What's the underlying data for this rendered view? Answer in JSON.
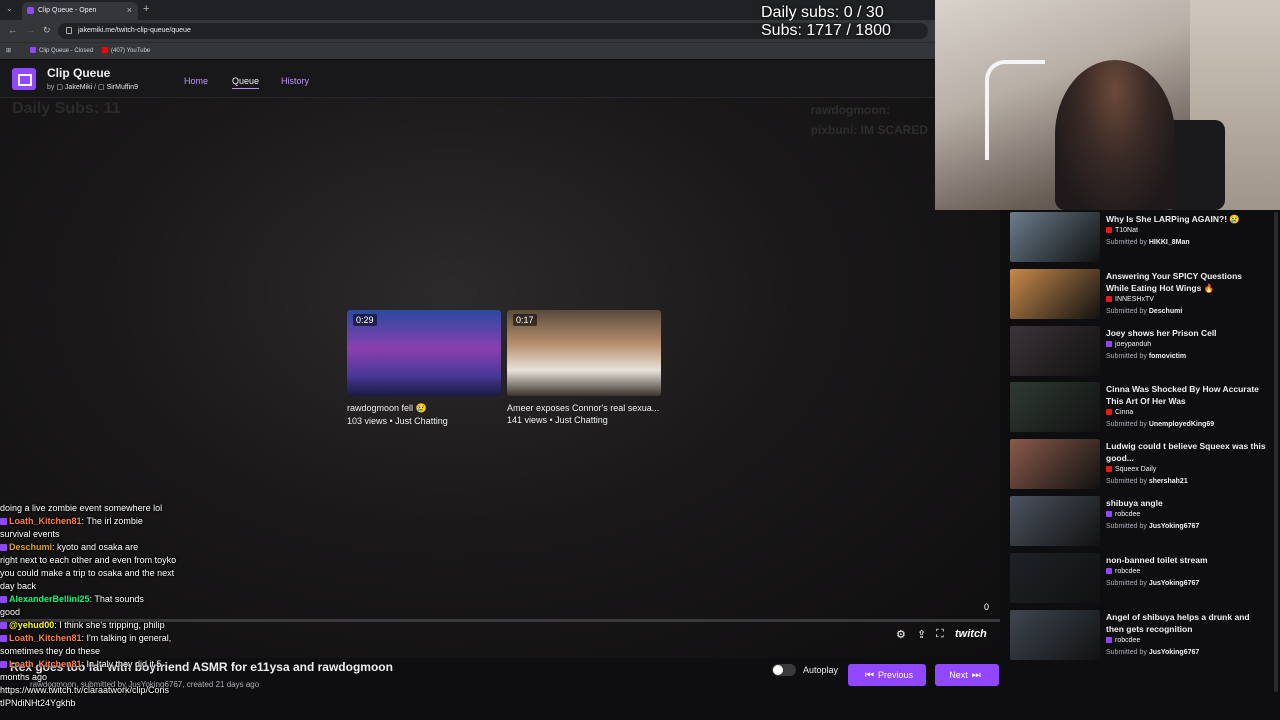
{
  "browser": {
    "tab_title": "Clip Queue - Open",
    "url": "jakemiki.me/twitch-clip-queue/queue",
    "bookmarks": [
      "Clip Queue - Closed",
      "(407) YouTube"
    ]
  },
  "app": {
    "title": "Clip Queue",
    "by_prefix": "by",
    "author1": "JakeMiki",
    "author_sep": "/",
    "author2": "SirMuffin9",
    "nav": [
      "Home",
      "Queue",
      "History"
    ]
  },
  "stage": {
    "ghost_left": "Daily Subs: 11",
    "ghost_right": [
      "rawdogmoon:",
      "pixbuni: IM SCARED"
    ]
  },
  "recommendations": [
    {
      "duration": "0:29",
      "title": "rawdogmoon fell 😢",
      "meta": "103 views • Just Chatting"
    },
    {
      "duration": "0:17",
      "title": "Ameer exposes Connor's real sexua...",
      "meta": "141 views • Just Chatting"
    }
  ],
  "player": {
    "progress": 0.0,
    "counter": "0",
    "twitch_word": "twitch"
  },
  "clip": {
    "title": "Rex goes too far with boyfriend ASMR for e11ysa and rawdogmoon",
    "subtitle": "rawdogmoon, submitted by JusYoking6767, created 21 days ago"
  },
  "controls": {
    "autoplay_label": "Autoplay",
    "previous_label": "Previous",
    "next_label": "Next"
  },
  "chat": [
    {
      "user": "",
      "text": "doing a live zombie event somewhere lol",
      "color": "#ffffff"
    },
    {
      "user": "Loath_Kitchen81",
      "text": ": The irl zombie",
      "color": "#ff7f50"
    },
    {
      "user": "",
      "text": "survival events",
      "color": "#ffffff"
    },
    {
      "user": "Deschumi",
      "text": ": kyoto and osaka are",
      "color": "#daa520"
    },
    {
      "user": "",
      "text": "right next to each other and even from toyko",
      "color": "#ffffff"
    },
    {
      "user": "",
      "text": "you could make a trip to osaka and the next",
      "color": "#ffffff"
    },
    {
      "user": "",
      "text": "day back",
      "color": "#ffffff"
    },
    {
      "user": "AlexanderBellini25",
      "text": ": That sounds",
      "color": "#00ff7f"
    },
    {
      "user": "",
      "text": "good",
      "color": "#ffffff"
    },
    {
      "user": "@yehud00",
      "text": ": I think she's tripping, philip",
      "color": "#ffff00"
    },
    {
      "user": "Loath_Kitchen81",
      "text": ": I'm talking in general,",
      "color": "#ff7f50"
    },
    {
      "user": "",
      "text": "sometimes they do these",
      "color": "#ffffff"
    },
    {
      "user": "Loath_Kitchen81",
      "text": ": In Italy they did it 5",
      "color": "#ff7f50"
    },
    {
      "user": "",
      "text": "months ago",
      "color": "#ffffff"
    },
    {
      "user": "",
      "text": "https://www.twitch.tv/claraatwork/clip/Cons",
      "color": "#ffffff"
    },
    {
      "user": "",
      "text": "tIPNdiNHt24Ygkhb",
      "color": "#ffffff"
    }
  ],
  "overlay": {
    "daily_subs": "Daily subs: 0 / 30",
    "subs": "Subs: 1717 / 1800"
  },
  "queue": [
    {
      "title": "Why Is She LARPing AGAIN?! 😢",
      "channel": "T10Nat",
      "submitted_prefix": "Submitted by",
      "submitter": "HIKKI_8Man",
      "platform": "youtube",
      "thumb": "#6a7d8c"
    },
    {
      "title": "Answering Your SPICY Questions While Eating Hot Wings 🔥",
      "channel": "INNESHxTV",
      "submitted_prefix": "Submitted by",
      "submitter": "Deschumi",
      "platform": "youtube",
      "thumb": "#c78a4a"
    },
    {
      "title": "Joey shows her Prison Cell",
      "channel": "joeypanduh",
      "submitted_prefix": "Submitted by",
      "submitter": "fomovictim",
      "platform": "twitch",
      "thumb": "#3b3338"
    },
    {
      "title": "Cinna Was Shocked By How Accurate This Art Of Her Was",
      "channel": "Cinna",
      "submitted_prefix": "Submitted by",
      "submitter": "UnemployedKing69",
      "platform": "youtube",
      "thumb": "#2f3a33"
    },
    {
      "title": "Ludwig could t believe Squeex was this good...",
      "channel": "Squeex Daily",
      "submitted_prefix": "Submitted by",
      "submitter": "shershah21",
      "platform": "youtube",
      "thumb": "#8a5a4a"
    },
    {
      "title": "shibuya angle",
      "channel": "robcdee",
      "submitted_prefix": "Submitted by",
      "submitter": "JusYoking6767",
      "platform": "twitch",
      "thumb": "#4c5460"
    },
    {
      "title": "non-banned toilet stream",
      "channel": "robcdee",
      "submitted_prefix": "Submitted by",
      "submitter": "JusYoking6767",
      "platform": "twitch",
      "thumb": "#1e2226"
    },
    {
      "title": "Angel of shibuya helps a drunk and then gets recognition",
      "channel": "robcdee",
      "submitted_prefix": "Submitted by",
      "submitter": "JusYoking6767",
      "platform": "twitch",
      "thumb": "#3e4650"
    }
  ]
}
